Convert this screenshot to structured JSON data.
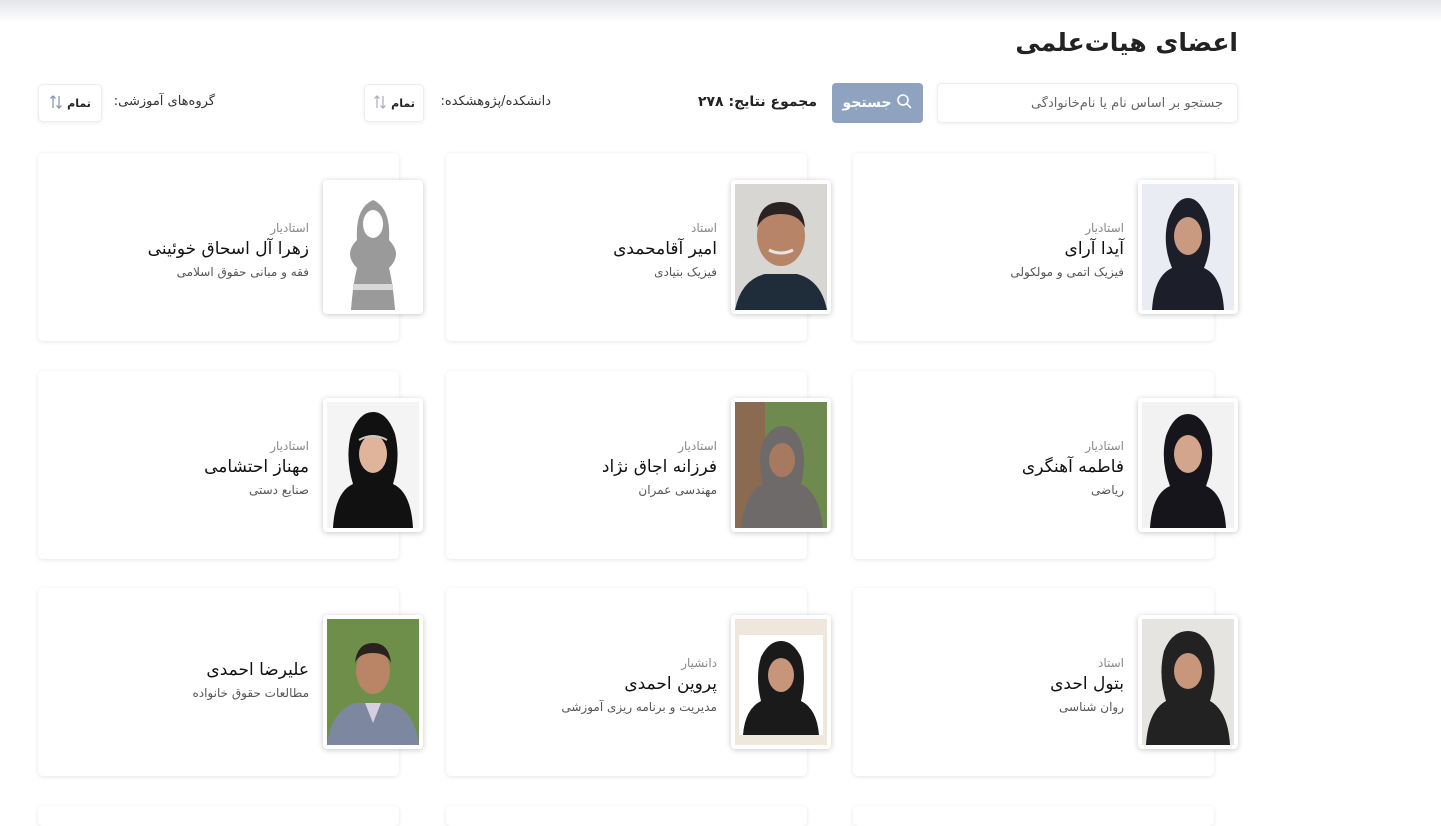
{
  "page": {
    "title": "اعضای هیات‌علمی"
  },
  "filters": {
    "search_placeholder": "جستجو بر اساس نام یا نام‌خانوادگی",
    "search_button": "جستجو",
    "total_label": "مجموع نتایج: ۲۷۸",
    "faculty_label": "دانشکده/پژوهشکده:",
    "faculty_value": "تمام",
    "group_label": "گروه‌های آموزشی:",
    "group_value": "تمام"
  },
  "colors": {
    "accent": "#8fa3c0"
  },
  "members": [
    {
      "rank": "استادیار",
      "name": "آیدا آرای",
      "dept": "فیزیک اتمی و مولکولی",
      "photo": "female-hijab-icon"
    },
    {
      "rank": "استاد",
      "name": "امیر آقامحمدی",
      "dept": "فیزیک بنیادی",
      "photo": "male-portrait-icon"
    },
    {
      "rank": "استادیار",
      "name": "زهرا آل اسحاق خوئینی",
      "dept": "فقه و مبانی حقوق اسلامی",
      "photo": "placeholder-female-icon"
    },
    {
      "rank": "استادیار",
      "name": "فاطمه آهنگری",
      "dept": "ریاضی",
      "photo": "female-hijab-icon"
    },
    {
      "rank": "استادیار",
      "name": "فرزانه اجاق نژاد",
      "dept": "مهندسی عمران",
      "photo": "female-scarf-icon"
    },
    {
      "rank": "استادیار",
      "name": "مهناز احتشامی",
      "dept": "صنایع دستی",
      "photo": "female-hijab-icon"
    },
    {
      "rank": "استاد",
      "name": "بتول احدی",
      "dept": "روان شناسی",
      "photo": "female-hijab-icon"
    },
    {
      "rank": "دانشیار",
      "name": "پروین احمدی",
      "dept": "مدیریت و برنامه ریزی آموزشی",
      "photo": "female-hijab-icon"
    },
    {
      "rank": "",
      "name": "علیرضا احمدی",
      "dept": "مطالعات حقوق خانواده",
      "photo": "male-portrait-icon"
    }
  ]
}
